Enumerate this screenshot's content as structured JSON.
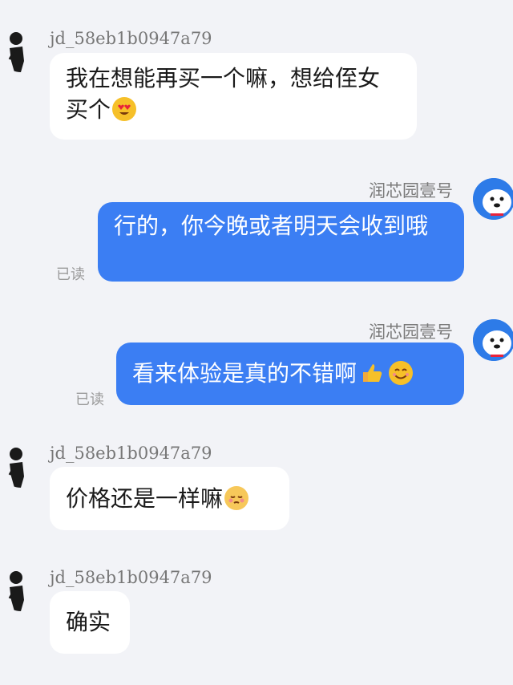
{
  "messages": [
    {
      "sender": "jd_58eb1b0947a79",
      "text": "我在想能再买一个嘛，想给侄女买个",
      "emoji": "heart-eyes"
    },
    {
      "sender": "润芯园壹号",
      "text": "行的，你今晚或者明天会收到哦",
      "status": "已读"
    },
    {
      "sender": "润芯园壹号",
      "text": "看来体验是真的不错啊",
      "emoji": "thumbs-up smiling-face",
      "status": "已读"
    },
    {
      "sender": "jd_58eb1b0947a79",
      "text": "价格还是一样嘛",
      "emoji": "blushing-face"
    },
    {
      "sender": "jd_58eb1b0947a79",
      "text": "确实"
    }
  ],
  "colors": {
    "background": "#f2f3f7",
    "incoming_bubble": "#ffffff",
    "outgoing_bubble": "#3b7ef3",
    "bot_avatar": "#2d7be8"
  }
}
